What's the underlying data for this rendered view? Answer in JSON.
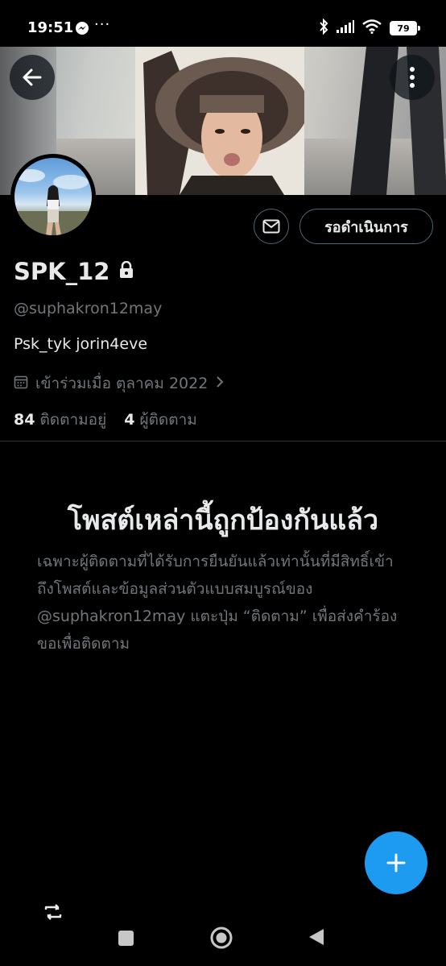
{
  "status_bar": {
    "time": "19:51",
    "dots": "···",
    "battery": "79"
  },
  "profile": {
    "display_name": "SPK_12",
    "handle": "@suphakron12may",
    "bio": "Psk_tyk jorin4eve",
    "joined": "เข้าร่วมเมื่อ ตุลาคม 2022",
    "following_count": "84",
    "following_label": "ติดตามอยู่",
    "followers_count": "4",
    "followers_label": "ผู้ติดตาม",
    "pending_button": "รอดำเนินการ"
  },
  "protected": {
    "title": "โพสต์เหล่านี้ถูกป้องกันแล้ว",
    "body": "เฉพาะผู้ติดตามที่ได้รับการยืนยันแล้วเท่านั้นที่มีสิทธิ์เข้าถึงโพสต์และข้อมูลส่วนตัวแบบสมบูรณ์ของ @suphakron12may แตะปุ่ม “ติดตาม” เพื่อส่งคำร้องขอเพื่อติดตาม"
  },
  "colors": {
    "accent": "#1d9bf0",
    "background": "#000000",
    "secondary_text": "#71767b"
  },
  "icons": {
    "back": "arrow-left-icon",
    "more": "more-vertical-icon",
    "message": "envelope-icon",
    "lock": "lock-icon",
    "calendar": "calendar-icon",
    "chevron": "chevron-right-icon",
    "compose": "plus-icon",
    "retweet": "retweet-icon"
  }
}
